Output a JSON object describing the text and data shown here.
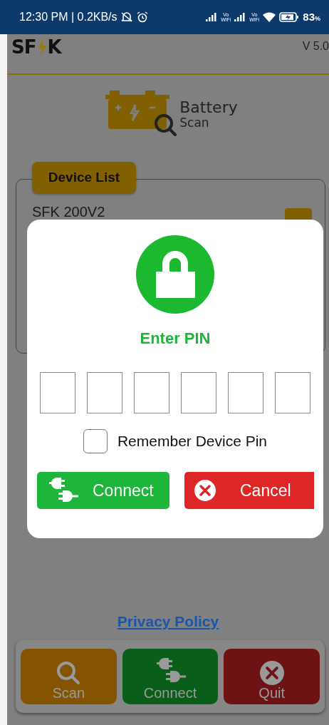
{
  "status_bar": {
    "time": "12:30 PM | 0.2KB/s",
    "sims": [
      {
        "top": "Vo",
        "bottom": "WiFi"
      },
      {
        "top": "Vo",
        "bottom": "WiFi"
      }
    ],
    "battery": "83",
    "battery_unit": "%"
  },
  "header": {
    "logo_left": "SF",
    "logo_right": "K",
    "version": "V 5.0"
  },
  "app_logo": {
    "title": "Battery",
    "subtitle": "Scan"
  },
  "device_list": {
    "title": "Device List",
    "devices": [
      {
        "name": "SFK 200V2"
      }
    ]
  },
  "dialog": {
    "title": "Enter PIN",
    "pin_fields": [
      {
        "kind": "digit"
      },
      {
        "kind": "digit"
      },
      {
        "kind": "digit"
      },
      {
        "kind": "digit"
      },
      {
        "kind": "digit"
      },
      {
        "kind": "digit"
      }
    ],
    "remember": {
      "label": "Remember Device Pin",
      "checked": false
    },
    "buttons": [
      {
        "kind": "connect",
        "label": "Connect"
      },
      {
        "kind": "cancel",
        "label": "Cancel"
      }
    ]
  },
  "privacy_link": "Privacy Policy",
  "bottom_nav": [
    {
      "kind": "scan",
      "label": "Scan"
    },
    {
      "kind": "connect",
      "label": "Connect"
    },
    {
      "kind": "quit",
      "label": "Quit"
    }
  ]
}
